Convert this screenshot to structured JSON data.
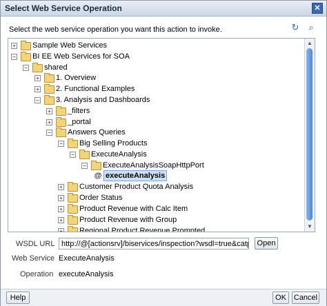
{
  "dialog": {
    "title": "Select Web Service Operation",
    "close_glyph": "✕",
    "instruction": "Select the web service operation you want this action to invoke.",
    "icons": [
      "refresh-icon",
      "find-icon"
    ]
  },
  "tree": {
    "expander_plus": "+",
    "expander_minus": "−",
    "op_glyph": "@",
    "items": [
      {
        "label": "Sample Web Services",
        "state": "collapsed",
        "level": 0
      },
      {
        "label": "BI EE Web Services for SOA",
        "state": "expanded",
        "level": 0
      },
      {
        "label": "shared",
        "state": "expanded",
        "level": 1
      },
      {
        "label": "1. Overview",
        "state": "collapsed",
        "level": 2
      },
      {
        "label": "2. Functional Examples",
        "state": "collapsed",
        "level": 2
      },
      {
        "label": "3. Analysis and Dashboards",
        "state": "expanded",
        "level": 2
      },
      {
        "label": "_filters",
        "state": "collapsed",
        "level": 3
      },
      {
        "label": "_portal",
        "state": "collapsed",
        "level": 3
      },
      {
        "label": "Answers Queries",
        "state": "expanded",
        "level": 3
      },
      {
        "label": "Big Selling Products",
        "state": "expanded",
        "level": 4
      },
      {
        "label": "ExecuteAnalysis",
        "state": "expanded",
        "level": 5
      },
      {
        "label": "ExecuteAnalysisSoapHttpPort",
        "state": "expanded",
        "level": 6
      },
      {
        "label": "executeAnalysis",
        "state": "selected",
        "level": 7
      },
      {
        "label": "Customer Product Quota Analysis",
        "state": "collapsed",
        "level": 4
      },
      {
        "label": "Order Status",
        "state": "collapsed",
        "level": 4
      },
      {
        "label": "Product Revenue with Calc Item",
        "state": "collapsed",
        "level": 4
      },
      {
        "label": "Product Revenue with Group",
        "state": "collapsed",
        "level": 4
      },
      {
        "label": "Regional Product Revenue Prompted",
        "state": "collapsed",
        "level": 4
      }
    ]
  },
  "form": {
    "wsdl_label": "WSDL URL",
    "wsdl_value": "http://@[actionsrv]/biservices/inspection?wsdl=true&catpath=",
    "open_button": "Open",
    "web_service_label": "Web Service",
    "web_service_value": "ExecuteAnalysis",
    "operation_label": "Operation",
    "operation_value": "executeAnalysis"
  },
  "footer": {
    "help_button": "Help",
    "ok_button": "OK",
    "cancel_button": "Cancel"
  },
  "colors": {
    "selection": "#cfe0f6",
    "title_text": "#1c2a3c",
    "scroll_thumb": "#4f86d3"
  }
}
